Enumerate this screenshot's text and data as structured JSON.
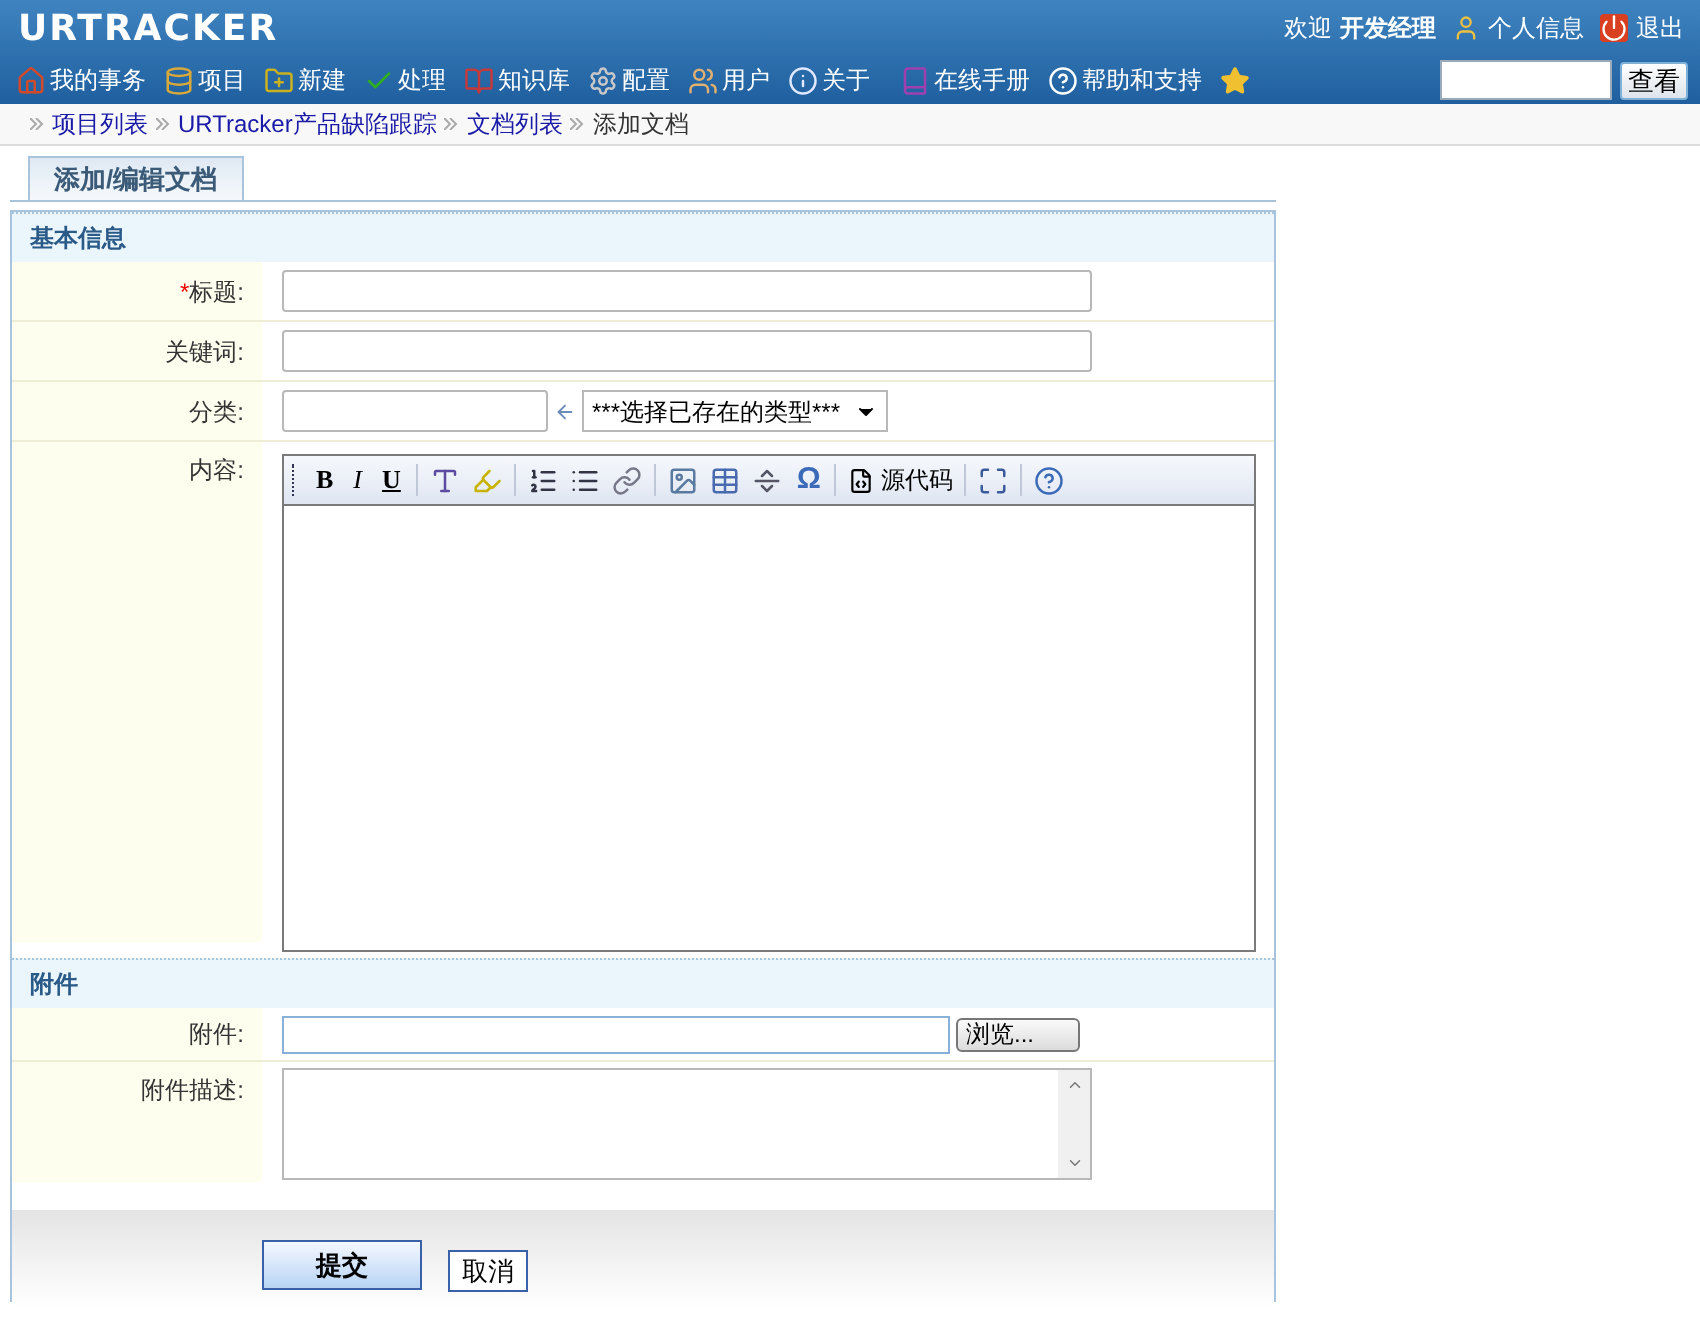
{
  "header": {
    "logo": "URTRACKER",
    "welcome": "欢迎",
    "user": "开发经理",
    "user_links": [
      "个人信息",
      "退出"
    ]
  },
  "nav": [
    {
      "label": "我的事务"
    },
    {
      "label": "项目"
    },
    {
      "label": "新建"
    },
    {
      "label": "处理"
    },
    {
      "label": "知识库"
    },
    {
      "label": "配置"
    },
    {
      "label": "用户"
    },
    {
      "label": "关于"
    },
    {
      "label": "在线手册"
    },
    {
      "label": "帮助和支持"
    }
  ],
  "search": {
    "button": "查看"
  },
  "breadcrumb": [
    {
      "label": "项目列表",
      "link": true
    },
    {
      "label": "URTracker产品缺陷跟踪",
      "link": true
    },
    {
      "label": "文档列表",
      "link": true
    },
    {
      "label": "添加文档",
      "link": false
    }
  ],
  "tabs": [
    {
      "label": "添加/编辑文档",
      "selected": true
    }
  ],
  "sections": [
    {
      "title": "基本信息",
      "fields": [
        {
          "kind": "text",
          "label": "标题:",
          "required_mark": "*"
        },
        {
          "kind": "text",
          "label": "关键词:"
        },
        {
          "kind": "category",
          "label": "分类:",
          "select": "***选择已存在的类型***"
        },
        {
          "kind": "editor",
          "label": "内容:",
          "toolbar": {
            "bold": "B",
            "italic": "I",
            "underline": "U",
            "omega": "Ω",
            "source": "源代码"
          }
        }
      ]
    },
    {
      "title": "附件",
      "fields": [
        {
          "kind": "file",
          "label": "附件:",
          "button": "浏览..."
        },
        {
          "kind": "textarea",
          "label": "附件描述:"
        }
      ]
    }
  ],
  "actions": [
    {
      "label": "提交",
      "primary": true
    },
    {
      "label": "取消",
      "primary": false
    }
  ]
}
